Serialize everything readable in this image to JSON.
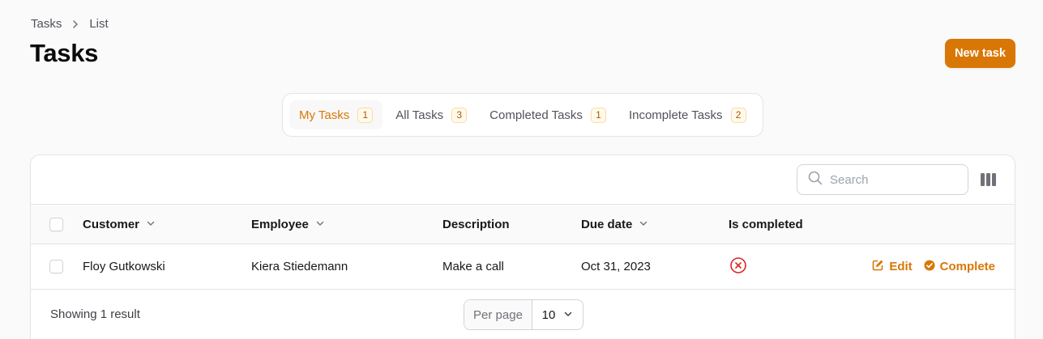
{
  "breadcrumb": {
    "items": [
      "Tasks",
      "List"
    ]
  },
  "page": {
    "title": "Tasks"
  },
  "header": {
    "new_button_label": "New task"
  },
  "colors": {
    "accent": "#d97706",
    "danger": "#dc2626"
  },
  "tabs": [
    {
      "label": "My Tasks",
      "count": "1",
      "active": true
    },
    {
      "label": "All Tasks",
      "count": "3",
      "active": false
    },
    {
      "label": "Completed Tasks",
      "count": "1",
      "active": false
    },
    {
      "label": "Incomplete Tasks",
      "count": "2",
      "active": false
    }
  ],
  "search": {
    "placeholder": "Search",
    "value": ""
  },
  "table": {
    "columns": [
      {
        "label": "Customer",
        "sortable": true
      },
      {
        "label": "Employee",
        "sortable": true
      },
      {
        "label": "Description",
        "sortable": false
      },
      {
        "label": "Due date",
        "sortable": true
      },
      {
        "label": "Is completed",
        "sortable": false
      }
    ],
    "rows": [
      {
        "customer": "Floy Gutkowski",
        "employee": "Kiera Stiedemann",
        "description": "Make a call",
        "due_date": "Oct 31, 2023",
        "is_completed": false,
        "status_icon": "x-circle-icon",
        "edit_label": "Edit",
        "complete_label": "Complete"
      }
    ]
  },
  "footer": {
    "result_text": "Showing 1 result",
    "per_page_label": "Per page",
    "per_page_value": "10"
  }
}
